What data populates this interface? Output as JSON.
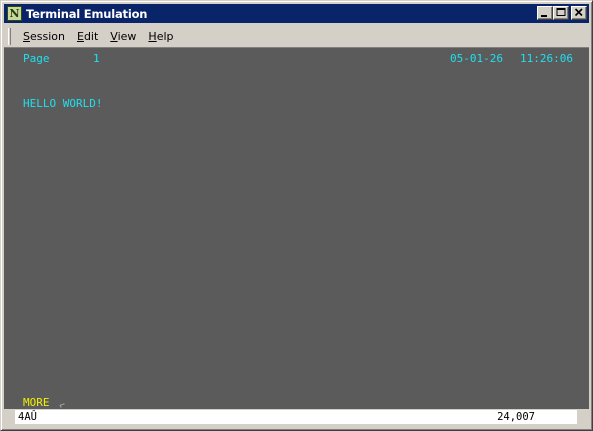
{
  "window": {
    "title": "Terminal Emulation",
    "icon_letter": "N",
    "icon": "terminal-app-icon"
  },
  "menu": {
    "items": [
      {
        "label": "Session",
        "accel": "S"
      },
      {
        "label": "Edit",
        "accel": "E"
      },
      {
        "label": "View",
        "accel": "V"
      },
      {
        "label": "Help",
        "accel": "H"
      }
    ]
  },
  "terminal": {
    "page_label": "Page",
    "page_number": "1",
    "date": "05-01-26",
    "time": "11:26:06",
    "message": "HELLO WORLD!",
    "more_label": "MORE",
    "colors": {
      "background": "#5b5b5b",
      "text": "#1fe0ee",
      "more": "#f0f000"
    }
  },
  "status": {
    "left": "4AÛ",
    "right": "24,007"
  }
}
